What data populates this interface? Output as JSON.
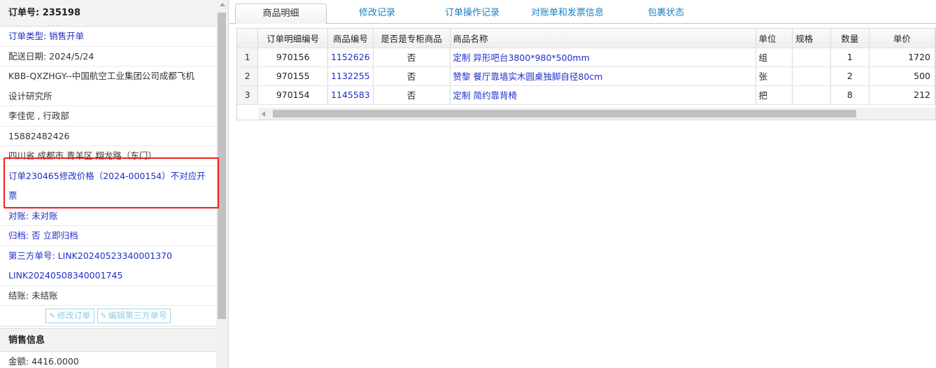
{
  "left": {
    "order_no": "订单号: 235198",
    "rows": [
      {
        "text": "订单类型: 销售开单",
        "style": "link"
      },
      {
        "text": "配送日期: 2024/5/24",
        "style": "plain"
      },
      {
        "text": "KBB-QXZHGY--中国航空工业集团公司成都飞机",
        "style": "plain wrap1"
      },
      {
        "text": "设计研究所",
        "style": "plain"
      },
      {
        "text": "李佳伲 , 行政部",
        "style": "plain"
      },
      {
        "text": "15882482426",
        "style": "plain"
      },
      {
        "text": "四川省 成都市 青羊区 翔龙路（东门）",
        "style": "plain"
      },
      {
        "text": "订单230465修改价格（2024-000154）不对应开",
        "style": "link wrap1"
      },
      {
        "text": "票",
        "style": "link"
      },
      {
        "text": "对账: 未对账",
        "style": "link"
      },
      {
        "text": "归档:  否 立即归档",
        "style": "link"
      },
      {
        "text": "第三方单号: LINK20240523340001370",
        "style": "link wrap1"
      },
      {
        "text": "LINK20240508340001745",
        "style": "link"
      },
      {
        "text": "结账: 未结账",
        "style": "plain"
      }
    ],
    "btn_modify": "修改订单",
    "btn_edit_third": "编辑第三方单号",
    "sales_head": "销售信息",
    "amount": "金额: 4416.0000"
  },
  "tabs": [
    "商品明细",
    "修改记录",
    "订单操作记录",
    "对账单和发票信息",
    "包裹状态"
  ],
  "table": {
    "headers": [
      "",
      "订单明细编号",
      "商品编号",
      "是否是专柜商品",
      "商品名称",
      "单位",
      "规格",
      "数量",
      "单价"
    ],
    "rows": [
      [
        "1",
        "970156",
        "1152626",
        "否",
        "定制 异形吧台3800*980*500mm",
        "组",
        "",
        "1",
        "1720"
      ],
      [
        "2",
        "970155",
        "1132255",
        "否",
        "赞黎 餐厅靠墙实木圆桌独脚自径80cm",
        "张",
        "",
        "2",
        "500"
      ],
      [
        "3",
        "970154",
        "1145583",
        "否",
        "定制 简约靠背椅",
        "把",
        "",
        "8",
        "212"
      ]
    ]
  },
  "colors": {
    "link": "#1d2fc8",
    "highlight": "#f01e1e",
    "tab_link": "#1a7fc2"
  },
  "icons": {
    "edit": "edit-icon"
  }
}
